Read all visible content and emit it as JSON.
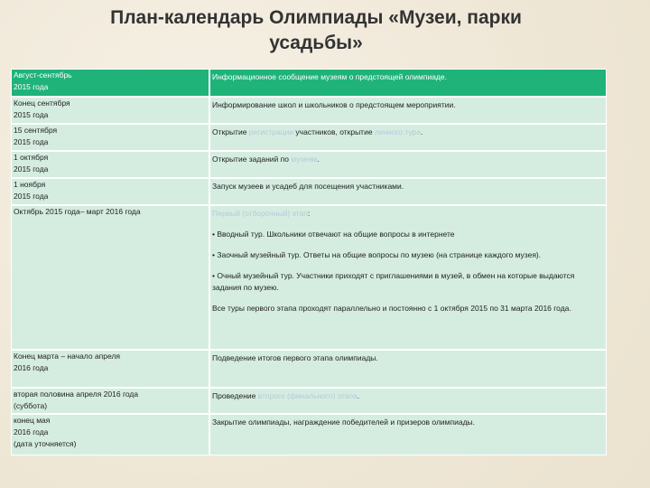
{
  "title": "План-календарь Олимпиады «Музеи, парки усадьбы»",
  "rows": [
    {
      "date": [
        "Август-сентябрь",
        "2015 года"
      ],
      "desc": "Информационное сообщение музеям о предстоящей олимпиаде."
    },
    {
      "date": [
        "Конец сентября",
        "2015 года"
      ],
      "desc": "Информирование школ и школьников о предстоящем мероприятии."
    },
    {
      "date": [
        "15 сентября",
        "2015 года"
      ],
      "desc_pre": "Открытие ",
      "desc_link1": "регистрации",
      "desc_mid": " участников, открытие ",
      "desc_link2": "личного тура",
      "desc_post": "."
    },
    {
      "date": [
        "1 октября",
        "2015 года"
      ],
      "desc_pre": "Открытие заданий по ",
      "desc_link1": "музеям",
      "desc_post": "."
    },
    {
      "date": [
        "1 ноября",
        "2015 года"
      ],
      "desc": "Запуск музеев и усадеб для посещения участниками."
    },
    {
      "date": [
        "Октябрь 2015 года– март 2016 года"
      ],
      "desc_link": "Первый (отборочный) этап",
      "desc_link_post": ":",
      "bullets": [
        "Вводный тур. Школьники отвечают на общие вопросы в интернете",
        "Заочный музейный тур. Ответы на общие вопросы по музею (на странице каждого музея).",
        "Очный музейный тур. Участники приходят с приглашениями в музей, в обмен на которые выдаются задания по музею."
      ],
      "note": "Все туры первого этапа проходят параллельно и постоянно с 1 октября 2015 по 31 марта 2016 года."
    },
    {
      "date": [
        "Конец марта – начало апреля",
        "2016 года"
      ],
      "desc": "Подведение итогов первого этапа олимпиады."
    },
    {
      "date": [
        "вторая половина апреля 2016 года",
        "(суббота)"
      ],
      "desc_pre": "Проведение ",
      "desc_link1": "второго (финального) этапа",
      "desc_post": "."
    },
    {
      "date": [
        "конец мая",
        "2016 года",
        "(дата уточняется)"
      ],
      "desc": "Закрытие олимпиады, награждение победителей и призеров олимпиады."
    }
  ]
}
